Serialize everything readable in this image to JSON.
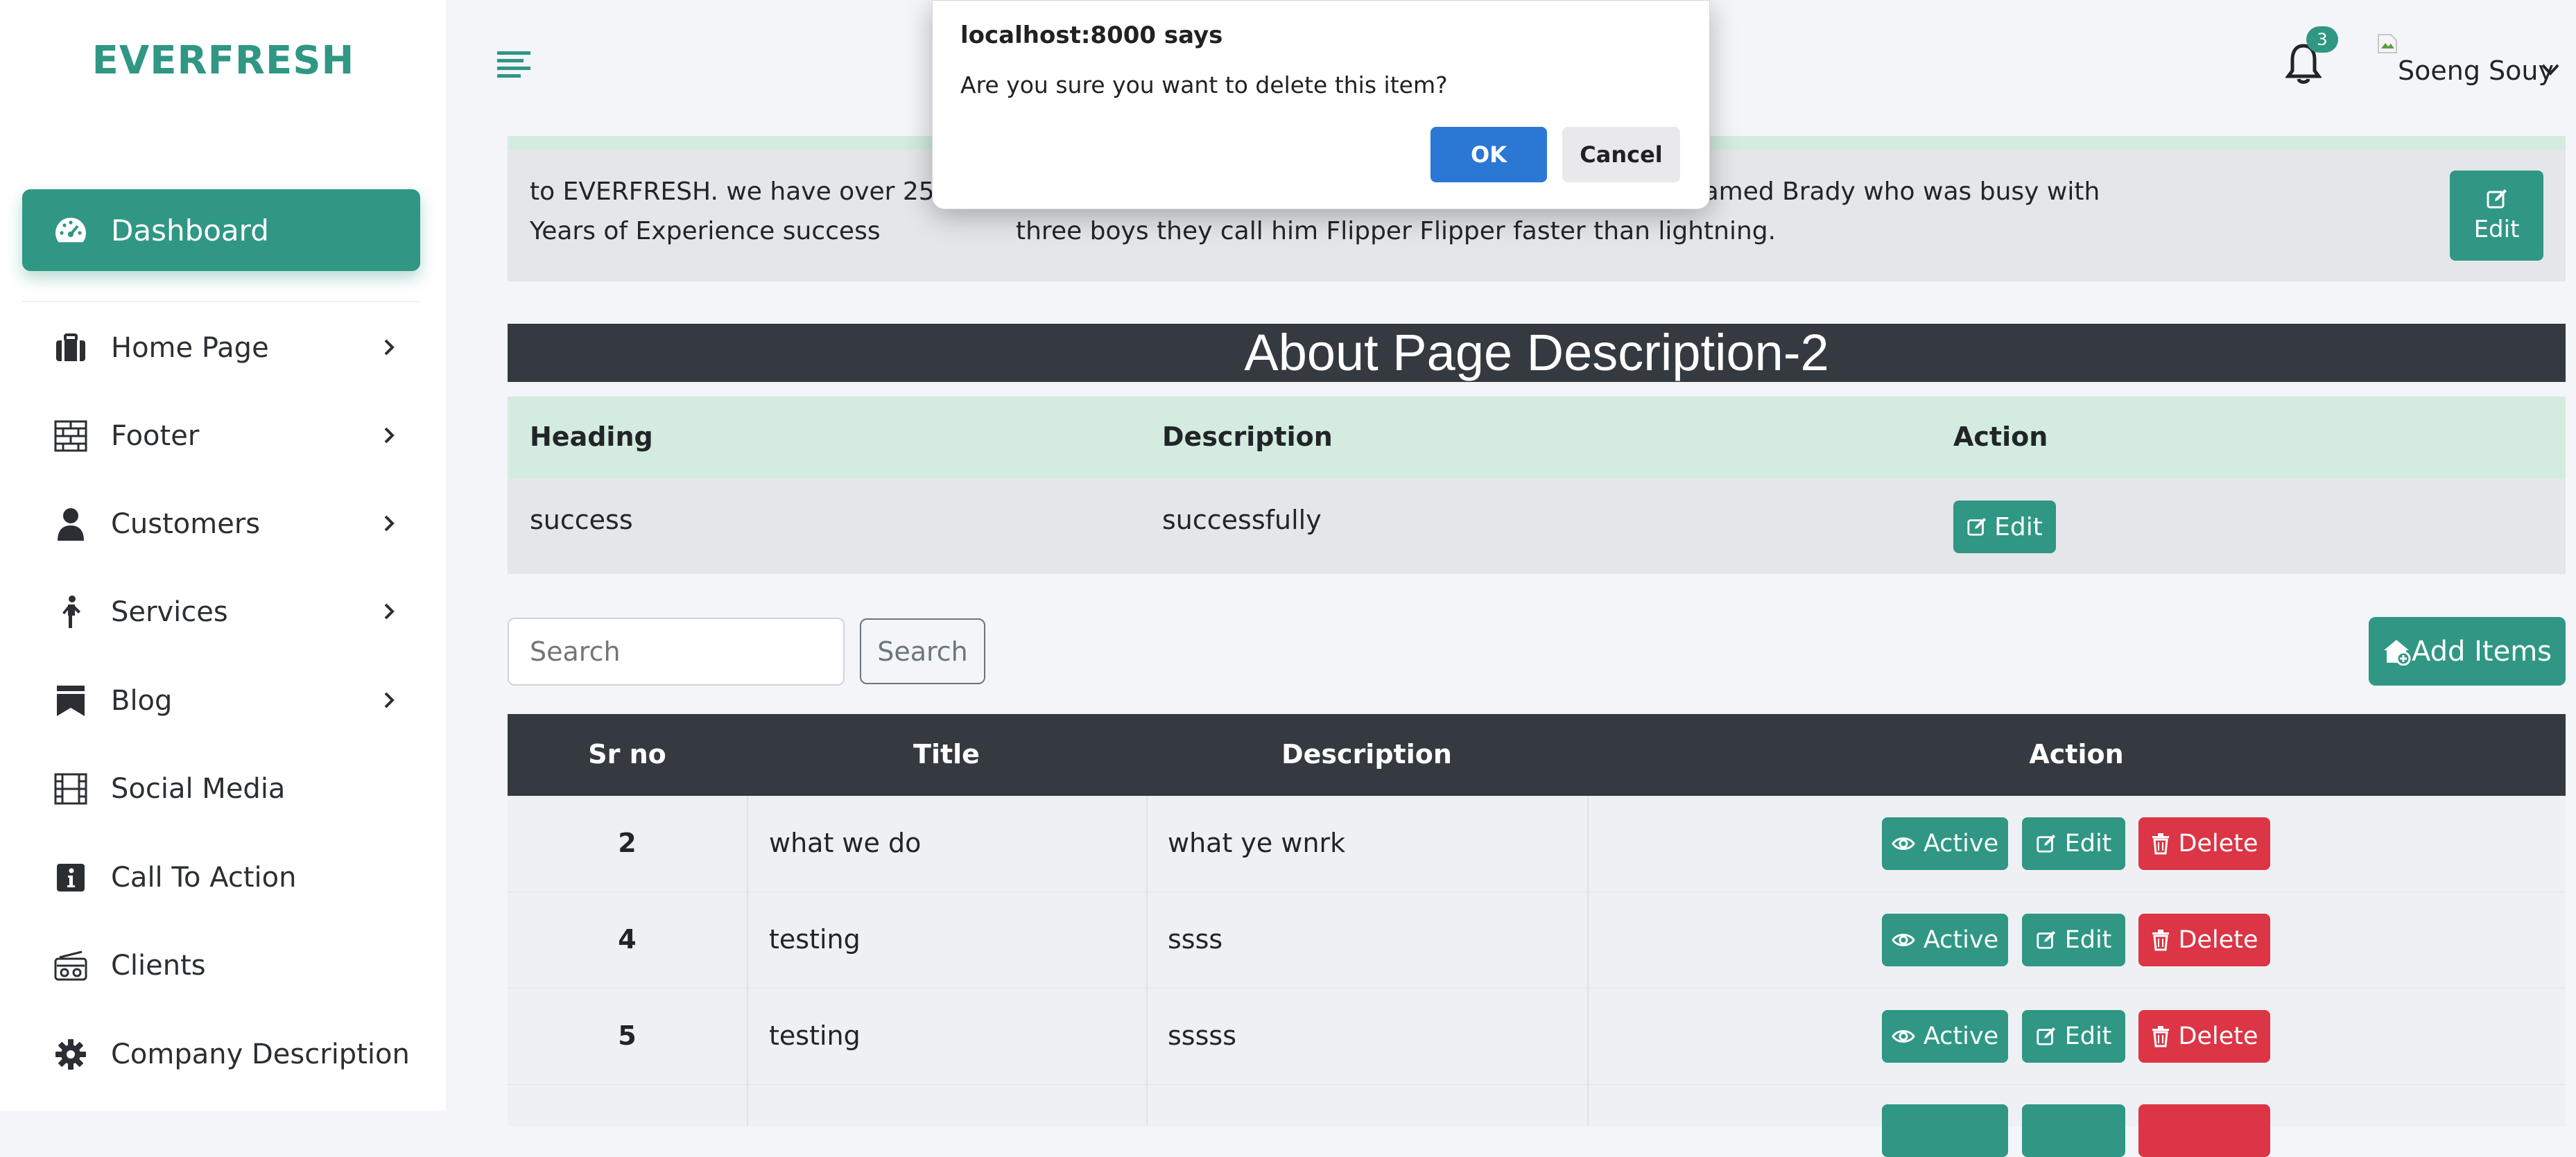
{
  "brand": "EVERFRESH",
  "sidebar": {
    "dashboard": "Dashboard",
    "items": [
      {
        "label": "Home Page",
        "icon": "briefcase-icon",
        "has_chevron": true
      },
      {
        "label": "Footer",
        "icon": "brick-wall-icon",
        "has_chevron": true
      },
      {
        "label": "Customers",
        "icon": "user-icon",
        "has_chevron": true
      },
      {
        "label": "Services",
        "icon": "person-walking-icon",
        "has_chevron": true
      },
      {
        "label": "Blog",
        "icon": "bookmark-flag-icon",
        "has_chevron": true
      },
      {
        "label": "Social Media",
        "icon": "film-icon",
        "has_chevron": false
      },
      {
        "label": "Call To Action",
        "icon": "info-icon",
        "has_chevron": false
      },
      {
        "label": "Clients",
        "icon": "radio-icon",
        "has_chevron": false
      },
      {
        "label": "Company Description",
        "icon": "gear-icon",
        "has_chevron": false
      }
    ]
  },
  "header": {
    "notification_count": "3",
    "user_name": "Soeng Souy"
  },
  "description_strip": {
    "text1": "to EVERFRESH. we have over 25 Years of Experience success",
    "text2": "te above the law texas tea here is the story of a man named Brady who was busy with three boys they call him Flipper Flipper faster than lightning.",
    "edit_label": "Edit"
  },
  "about2": {
    "title": "About Page Description-2",
    "headers": {
      "heading": "Heading",
      "description": "Description",
      "action": "Action"
    },
    "row": {
      "heading": "success",
      "description": "successfully",
      "edit_label": "Edit"
    }
  },
  "search": {
    "placeholder": "Search",
    "button_label": "Search",
    "add_label": "Add Items"
  },
  "table": {
    "headers": {
      "sr": "Sr no",
      "title": "Title",
      "description": "Description",
      "action": "Action"
    },
    "rows": [
      {
        "sr": "2",
        "title": "what we do",
        "description": "what ye wnrk"
      },
      {
        "sr": "4",
        "title": "testing",
        "description": "ssss"
      },
      {
        "sr": "5",
        "title": "testing",
        "description": "sssss"
      }
    ],
    "action_labels": {
      "active": "Active",
      "edit": "Edit",
      "delete": "Delete"
    }
  },
  "dialog": {
    "title": "localhost:8000 says",
    "message": "Are you sure you want to delete this item?",
    "ok": "OK",
    "cancel": "Cancel"
  },
  "colors": {
    "accent": "#2f9784",
    "dark": "#343a40",
    "danger": "#dc3545",
    "dialog_ok": "#2b77d4"
  }
}
